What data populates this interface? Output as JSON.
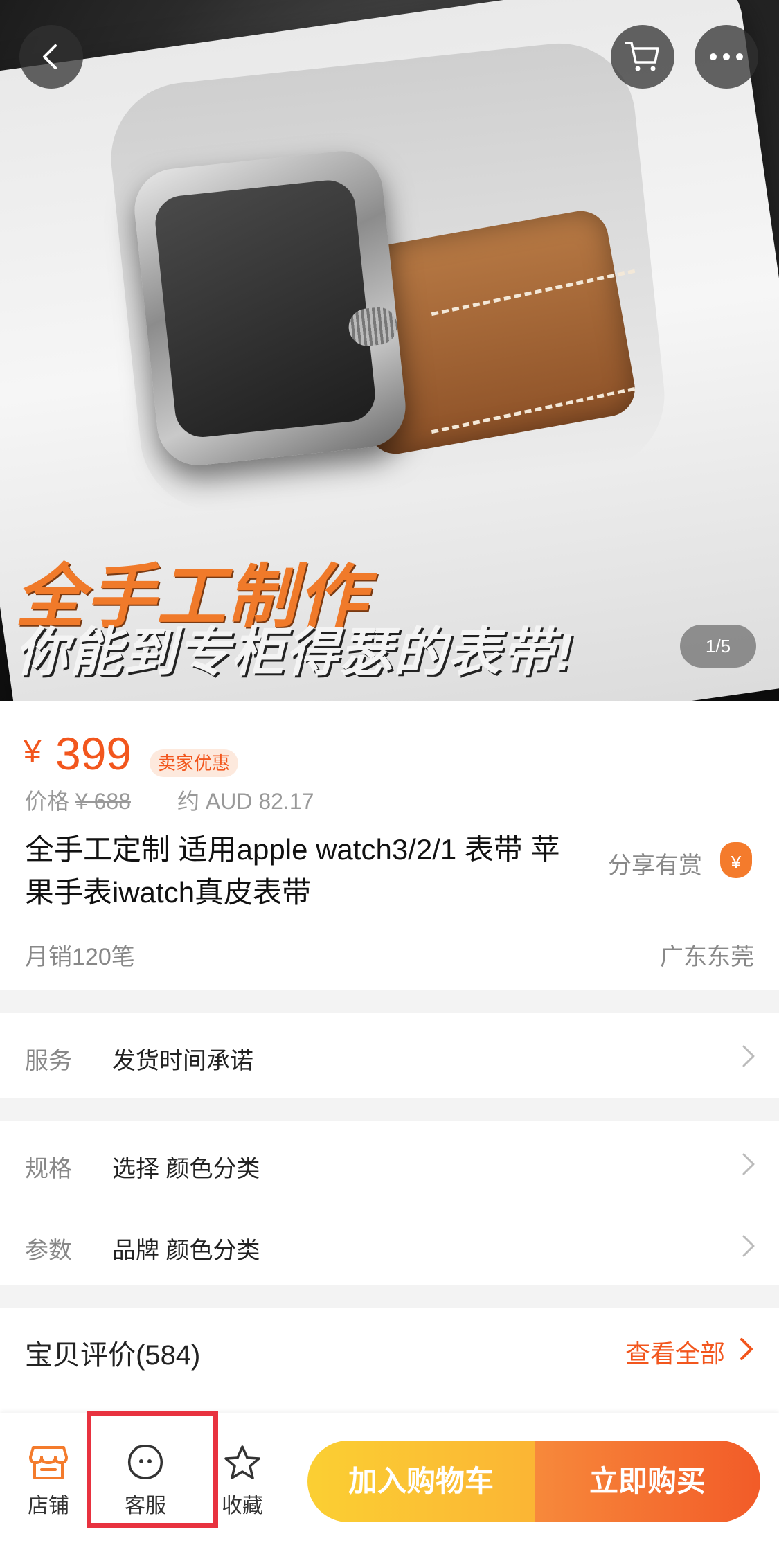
{
  "hero": {
    "promo_line1": "全手工制作",
    "promo_line2": "你能到专柜得瑟的表带!",
    "image_counter": "1/5"
  },
  "price": {
    "currency": "¥",
    "value": "399",
    "seller_tag": "卖家优惠",
    "original_label": "价格",
    "original_price": "¥ 688",
    "converted": "约 AUD 82.17"
  },
  "product": {
    "title": "全手工定制 适用apple watch3/2/1 表带 苹果手表iwatch真皮表带",
    "share_label": "分享有赏",
    "share_icon": "¥",
    "monthly_sales": "月销120笔",
    "location": "广东东莞"
  },
  "rows": {
    "service": {
      "label": "服务",
      "value": "发货时间承诺"
    },
    "spec": {
      "label": "规格",
      "value": "选择  颜色分类"
    },
    "params": {
      "label": "参数",
      "value": "品牌 颜色分类"
    }
  },
  "reviews": {
    "title": "宝贝评价(584)",
    "see_all": "查看全部"
  },
  "bottom_bar": {
    "store": "店铺",
    "service": "客服",
    "favorite": "收藏",
    "add_to_cart": "加入购物车",
    "buy_now": "立即购买"
  },
  "colors": {
    "accent": "#f2561d",
    "highlight_box": "#e8323f",
    "cart_button": "#fbc133",
    "buy_button": "#f46b2f"
  }
}
